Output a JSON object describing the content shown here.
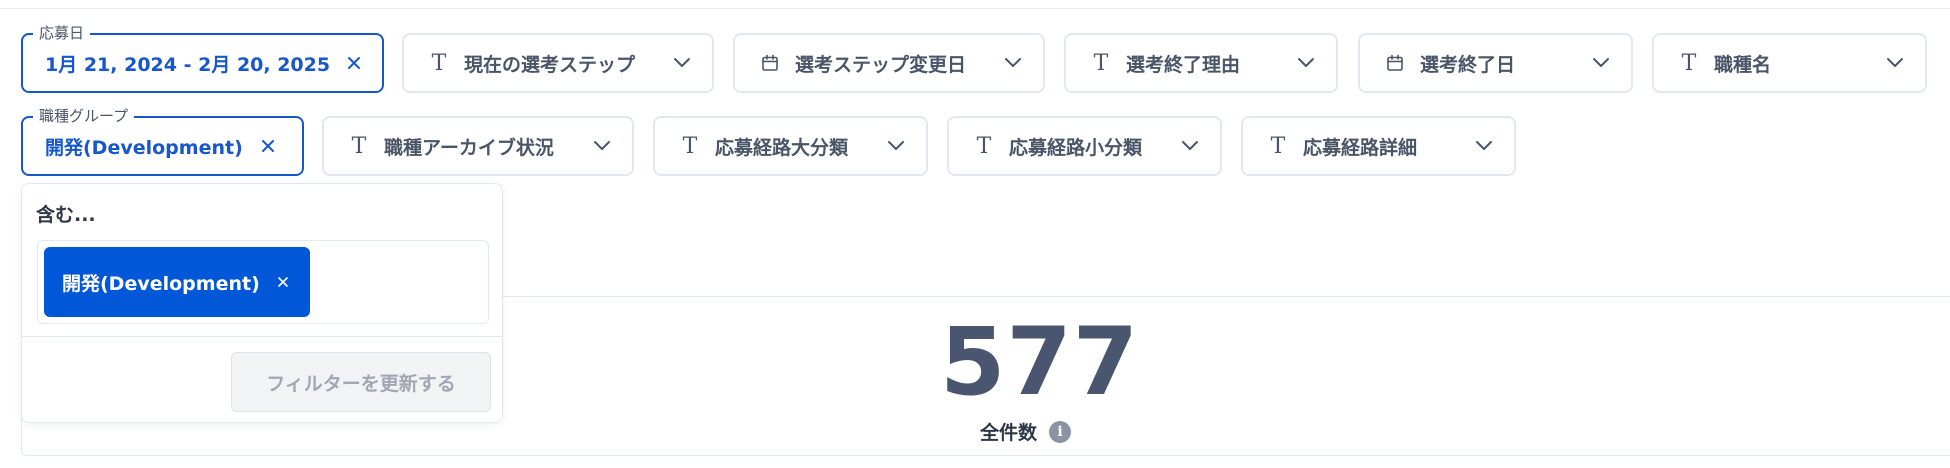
{
  "colors": {
    "accent": "#1757cc",
    "tag_bg": "#0057d8",
    "number": "#4a5670"
  },
  "filters_row1": [
    {
      "name": "filter-application-date",
      "active": true,
      "legend": "応募日",
      "value": "1月 21, 2024 - 2月 20, 2025"
    },
    {
      "name": "filter-current-step",
      "icon": "text-icon",
      "label": "現在の選考ステップ"
    },
    {
      "name": "filter-step-change-date",
      "icon": "calendar-icon",
      "label": "選考ステップ変更日"
    },
    {
      "name": "filter-end-reason",
      "icon": "text-icon",
      "label": "選考終了理由"
    },
    {
      "name": "filter-end-date",
      "icon": "calendar-icon",
      "label": "選考終了日"
    },
    {
      "name": "filter-job-name",
      "icon": "text-icon",
      "label": "職種名"
    }
  ],
  "filters_row2": [
    {
      "name": "filter-job-group",
      "active": true,
      "legend": "職種グループ",
      "value": "開発(Development)"
    },
    {
      "name": "filter-job-archive",
      "icon": "text-icon",
      "label": "職種アーカイブ状況"
    },
    {
      "name": "filter-route-major",
      "icon": "text-icon",
      "label": "応募経路大分類"
    },
    {
      "name": "filter-route-minor",
      "icon": "text-icon",
      "label": "応募経路小分類"
    },
    {
      "name": "filter-route-detail",
      "icon": "text-icon",
      "label": "応募経路詳細"
    }
  ],
  "popover": {
    "title": "含む...",
    "tags": [
      "開発(Development)"
    ],
    "update_button": "フィルターを更新する"
  },
  "metric": {
    "value": "577",
    "label": "全件数",
    "info_icon": "info-icon"
  }
}
